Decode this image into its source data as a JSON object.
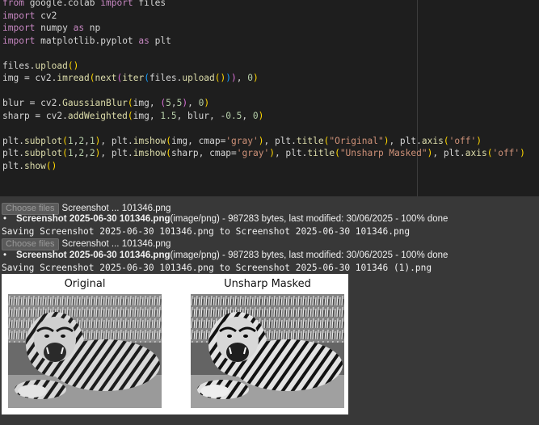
{
  "code_cell": {
    "lines": [
      "from google.colab import files",
      "import cv2",
      "import numpy as np",
      "import matplotlib.pyplot as plt",
      "",
      "files.upload()",
      "img = cv2.imread(next(iter(files.upload())), 0)",
      "",
      "blur = cv2.GaussianBlur(img, (5,5), 0)",
      "sharp = cv2.addWeighted(img, 1.5, blur, -0.5, 0)",
      "",
      "plt.subplot(1,2,1), plt.imshow(img, cmap='gray'), plt.title(\"Original\"), plt.axis('off')",
      "plt.subplot(1,2,2), plt.imshow(sharp, cmap='gray'), plt.title(\"Unsharp Masked\"), plt.axis('off')",
      "plt.show()"
    ]
  },
  "output": {
    "uploads": [
      {
        "button_label": "Choose files",
        "selected_file": "Screenshot ... 101346.png",
        "file_name": "Screenshot 2025-06-30 101346.png",
        "file_details": "(image/png) - 987283 bytes, last modified: 30/06/2025 - 100% done",
        "saving_message": "Saving Screenshot 2025-06-30 101346.png to Screenshot 2025-06-30 101346.png"
      },
      {
        "button_label": "Choose files",
        "selected_file": "Screenshot ... 101346.png",
        "file_name": "Screenshot 2025-06-30 101346.png",
        "file_details": "(image/png) - 987283 bytes, last modified: 30/06/2025 - 100% done",
        "saving_message": "Saving Screenshot 2025-06-30 101346.png to Screenshot 2025-06-30 101346 (1).png"
      }
    ],
    "figure": {
      "subplots": [
        {
          "title": "Original"
        },
        {
          "title": "Unsharp Masked"
        }
      ]
    }
  },
  "colors": {
    "code_background": "#1e1e1e",
    "output_background": "#383838",
    "keyword": "#c586c0",
    "function": "#dcdcaa",
    "number": "#b5cea8",
    "string": "#ce9178"
  }
}
